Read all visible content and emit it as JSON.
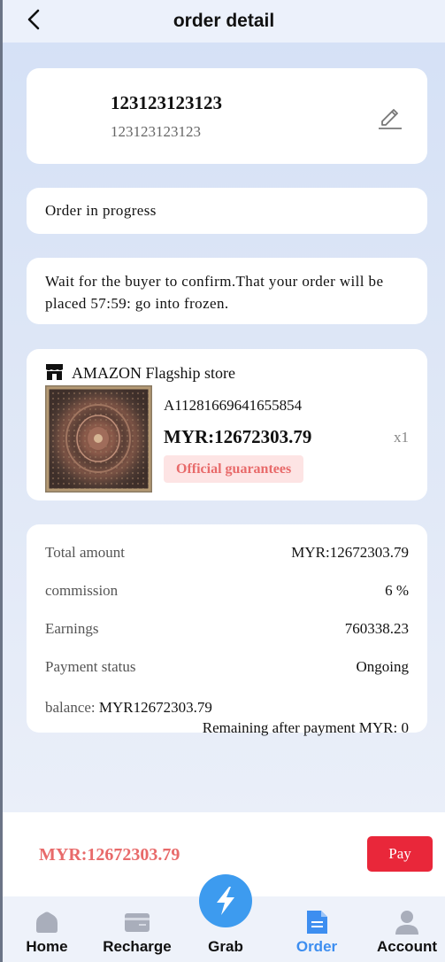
{
  "header": {
    "title": "order detail"
  },
  "user": {
    "name": "123123123123",
    "sub": "123123123123"
  },
  "status": {
    "text": "Order in progress"
  },
  "message": {
    "text": "Wait for the buyer to confirm.That your order will be placed 57:59: go into frozen."
  },
  "product": {
    "store": "AMAZON Flagship store",
    "id": "A11281669641655854",
    "price": "MYR:12672303.79",
    "qty": "x1",
    "badge": "Official guarantees"
  },
  "summary": {
    "rows": [
      {
        "label": "Total amount",
        "value": "MYR:12672303.79"
      },
      {
        "label": "commission",
        "value": "6 %"
      },
      {
        "label": "Earnings",
        "value": "760338.23"
      },
      {
        "label": "Payment status",
        "value": "Ongoing"
      }
    ],
    "balance_label": "balance:",
    "balance_value": "MYR12672303.79",
    "remaining": "Remaining after payment MYR:  0"
  },
  "pay": {
    "total": "MYR:12672303.79",
    "button": "Pay"
  },
  "tabs": [
    {
      "label": "Home",
      "icon": "home-icon"
    },
    {
      "label": "Recharge",
      "icon": "wallet-icon"
    },
    {
      "label": "Grab",
      "icon": "lightning-icon"
    },
    {
      "label": "Order",
      "icon": "document-icon",
      "active": true
    },
    {
      "label": "Account",
      "icon": "person-icon"
    }
  ],
  "colors": {
    "accent": "#3d8ef0",
    "pay_button": "#e9273a",
    "price_red": "#e86a6a",
    "badge_bg": "#fde4e4"
  }
}
